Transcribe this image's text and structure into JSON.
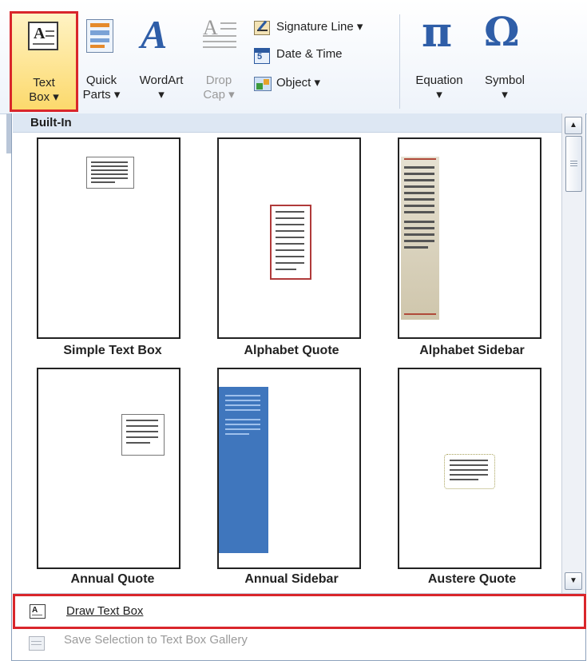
{
  "ribbon": {
    "text_box": {
      "line1": "Text",
      "line2": "Box ▾"
    },
    "quick_parts": {
      "line1": "Quick",
      "line2": "Parts ▾"
    },
    "wordart": {
      "line1": "WordArt",
      "line2": "▾"
    },
    "drop_cap": {
      "line1": "Drop",
      "line2": "Cap ▾"
    },
    "signature_line": "Signature Line ▾",
    "date_time": "Date & Time",
    "object": "Object ▾",
    "equation": {
      "line1": "Equation",
      "line2": "▾"
    },
    "symbol": {
      "line1": "Symbol",
      "line2": "▾"
    },
    "equation_glyph": "π",
    "symbol_glyph": "Ω"
  },
  "gallery": {
    "section_header": "Built-In",
    "items": [
      {
        "caption": "Simple Text Box"
      },
      {
        "caption": "Alphabet Quote"
      },
      {
        "caption": "Alphabet Sidebar"
      },
      {
        "caption": "Annual Quote"
      },
      {
        "caption": "Annual Sidebar"
      },
      {
        "caption": "Austere Quote"
      }
    ]
  },
  "menu": {
    "draw_text_box": "Draw Text Box",
    "save_selection": "Save Selection to Text Box Gallery"
  },
  "colors": {
    "highlight": "#d9262b",
    "annual_sidebar_blue": "#3f76bd",
    "alphabet_sidebar_tan": "#d7cfb9"
  }
}
